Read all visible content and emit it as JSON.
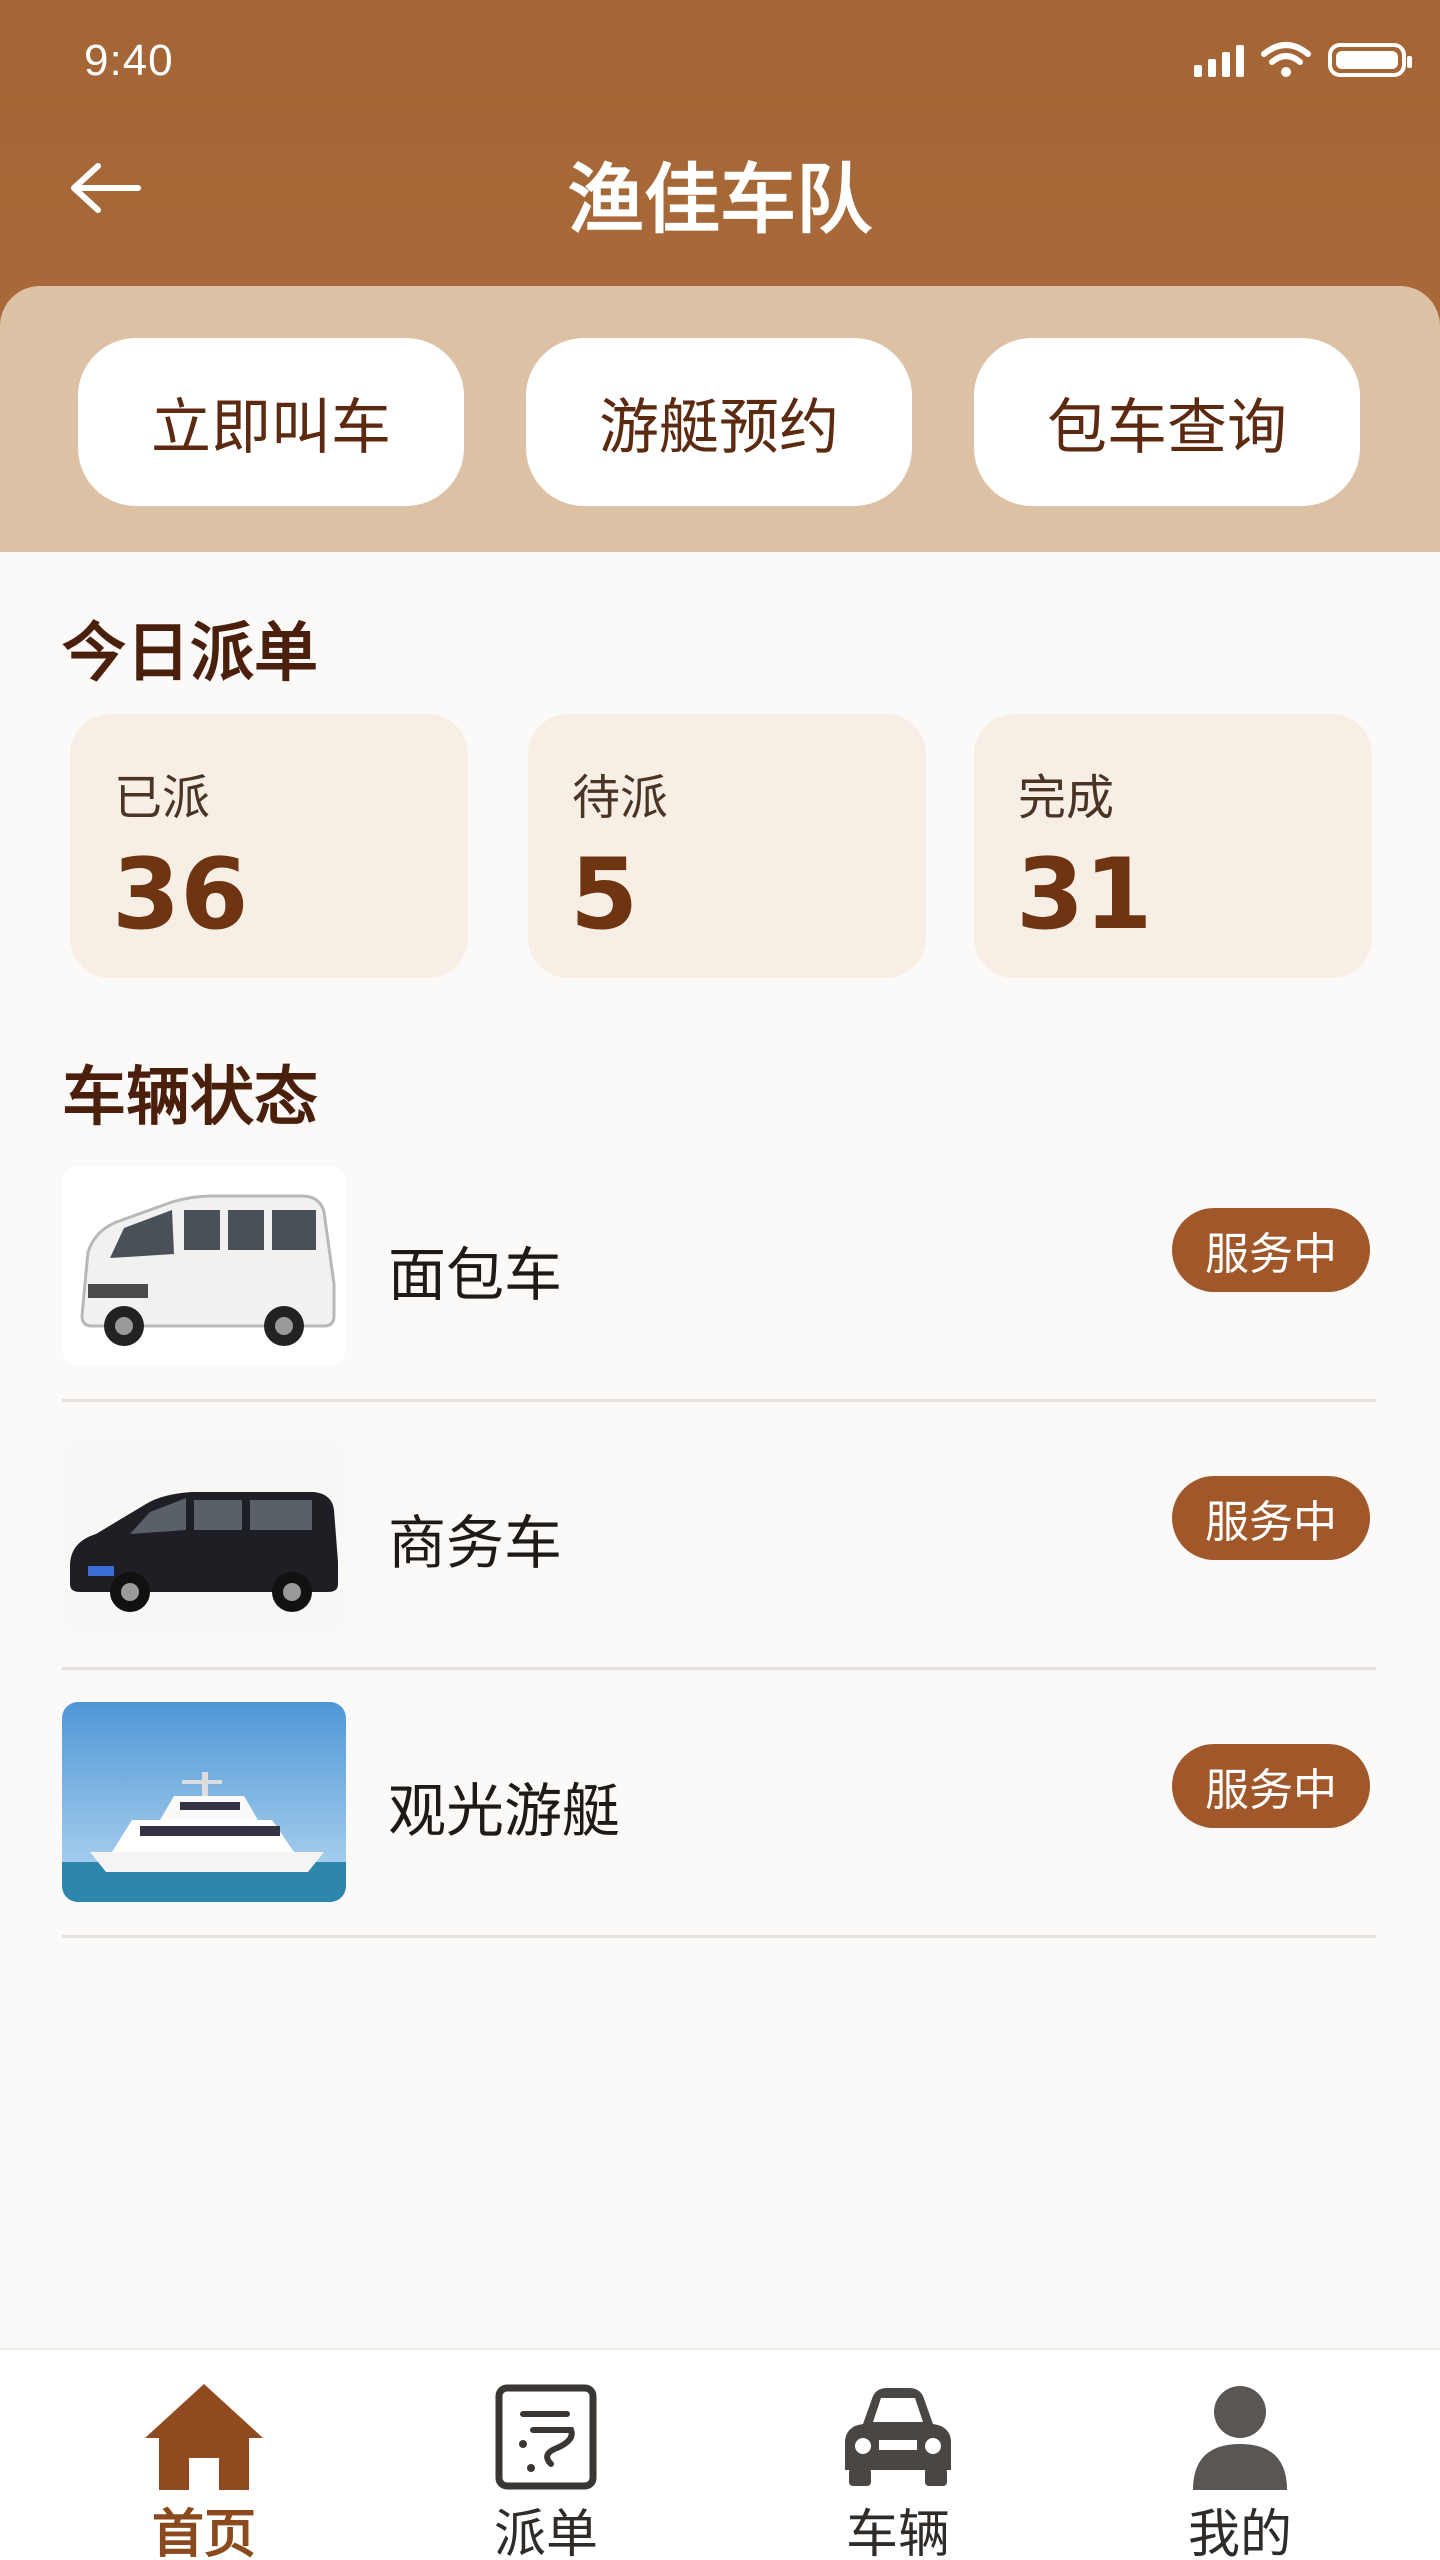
{
  "status_bar": {
    "time": "9:40"
  },
  "header": {
    "title": "渔佳车队"
  },
  "quick_actions": [
    {
      "label": "立即叫车"
    },
    {
      "label": "游艇预约"
    },
    {
      "label": "包车查询"
    }
  ],
  "dispatch": {
    "title": "今日派单",
    "stats": [
      {
        "label": "已派",
        "value": "36"
      },
      {
        "label": "待派",
        "value": "5"
      },
      {
        "label": "完成",
        "value": "31"
      }
    ]
  },
  "vehicles": {
    "title": "车辆状态",
    "items": [
      {
        "name": "面包车",
        "status": "服务中",
        "icon": "white-van-icon"
      },
      {
        "name": "商务车",
        "status": "服务中",
        "icon": "black-mpv-icon"
      },
      {
        "name": "观光游艇",
        "status": "服务中",
        "icon": "yacht-icon"
      }
    ]
  },
  "bottom_nav": [
    {
      "label": "首页",
      "icon": "home-icon",
      "active": true
    },
    {
      "label": "派单",
      "icon": "dispatch-icon",
      "active": false
    },
    {
      "label": "车辆",
      "icon": "car-icon",
      "active": false
    },
    {
      "label": "我的",
      "icon": "user-icon",
      "active": false
    }
  ],
  "colors": {
    "header": "#a46636",
    "panel": "#dcc1a5",
    "accent": "#a0582a",
    "card": "#f7efe6"
  }
}
